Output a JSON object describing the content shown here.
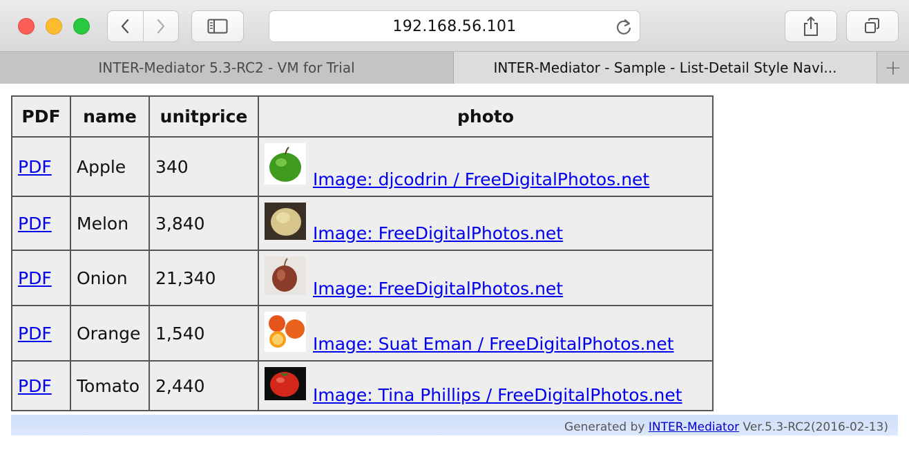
{
  "browser": {
    "address": "192.168.56.101",
    "tabs": [
      {
        "label": "INTER-Mediator 5.3-RC2 - VM for Trial",
        "active": false
      },
      {
        "label": "INTER-Mediator - Sample - List-Detail Style Navi...",
        "active": true
      }
    ],
    "new_tab_label": "+"
  },
  "table": {
    "headers": [
      "PDF",
      "name",
      "unitprice",
      "photo"
    ],
    "rows": [
      {
        "pdf": "PDF",
        "name": "Apple",
        "unitprice": "340",
        "photo_credit": "Image: djcodrin / FreeDigitalPhotos.net",
        "thumb_icon": "apple-photo"
      },
      {
        "pdf": "PDF",
        "name": "Melon",
        "unitprice": "3,840",
        "photo_credit": "Image: FreeDigitalPhotos.net",
        "thumb_icon": "melon-photo"
      },
      {
        "pdf": "PDF",
        "name": "Onion",
        "unitprice": "21,340",
        "photo_credit": "Image: FreeDigitalPhotos.net",
        "thumb_icon": "onion-photo"
      },
      {
        "pdf": "PDF",
        "name": "Orange",
        "unitprice": "1,540",
        "photo_credit": "Image: Suat Eman / FreeDigitalPhotos.net",
        "thumb_icon": "orange-photo"
      },
      {
        "pdf": "PDF",
        "name": "Tomato",
        "unitprice": "2,440",
        "photo_credit": "Image: Tina Phillips / FreeDigitalPhotos.net",
        "thumb_icon": "tomato-photo"
      }
    ]
  },
  "footer": {
    "prefix": "Generated by",
    "link": "INTER-Mediator",
    "suffix": "Ver.5.3-RC2(2016-02-13)"
  },
  "colors": {
    "link": "#0000ee",
    "table_bg": "#eeeeee",
    "footer_bg": "#d6e4fb"
  }
}
